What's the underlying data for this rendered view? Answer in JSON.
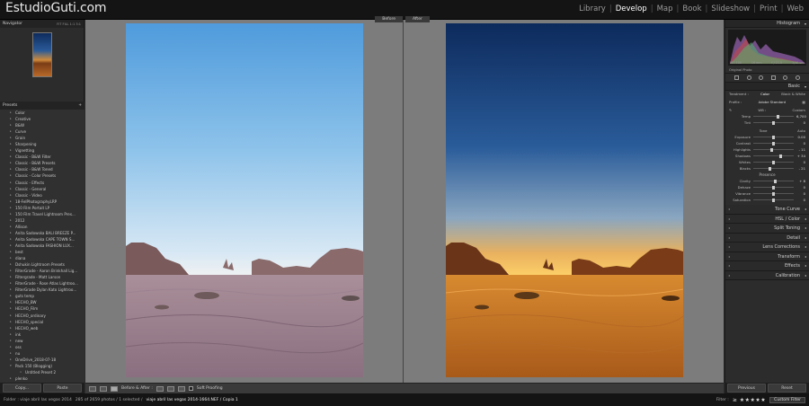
{
  "brand": "EstudioGuti.com",
  "modules": [
    "Library",
    "Develop",
    "Map",
    "Book",
    "Slideshow",
    "Print",
    "Web"
  ],
  "active_module": "Develop",
  "left": {
    "navigator_title": "Navigator",
    "navigator_zoom": "FIT  FILL  1:1  3:1",
    "presets_title": "Presets",
    "presets": [
      "Color",
      "Creative",
      "B&W",
      "Curve",
      "Grain",
      "Sharpening",
      "Vignetting",
      "Classic - B&W Filter",
      "Classic - B&W Presets",
      "Classic - B&W Toned",
      "Classic - Color Presets",
      "Classic - Effects",
      "Classic - General",
      "Classic - Video",
      "18-FelPhotographyLRP",
      "150 Film Portait LP",
      "150 Film Travel Lightroom Pres...",
      "2012",
      "Allison",
      "Anita Sadowska BALI BREEZE P...",
      "Anita Sadowska CAPE TOWN S...",
      "Anita Sadowska FASHION LUX...",
      "best",
      "diana",
      "Dshukin Lightroom Presets",
      "FilterGrade - Aaron Brinkhall Lig...",
      "Filtergrade - Matt Larson",
      "FilterGrade - Rose Atlas Lightroo...",
      "FilterGrade Dylan Kato Lightroo...",
      "guts temp",
      "HECHO_BW",
      "HECHO_Film",
      "HECHO_ordinary",
      "HECHO_special",
      "HECHO_web",
      "ink",
      "new",
      "oss",
      "nu",
      "OneDrive_2018-07-18",
      "Pack 150 (Blogging)"
    ],
    "sub_preset": "Untitled Preset 2",
    "last_preset": "plenko",
    "copy_label": "Copy...",
    "paste_label": "Paste"
  },
  "center": {
    "before_label": "Before",
    "after_label": "After"
  },
  "toolbar": {
    "view_mode": "Before & After :",
    "soft_proofing": "Soft Proofing"
  },
  "right": {
    "histogram_title": "Histogram",
    "histo_values": [
      "ISO 100",
      "16 mm",
      "f / 11.0",
      "1/40 sec"
    ],
    "original_photo": "Original Photo",
    "basic_title": "Basic",
    "treatment_label": "Treatment :",
    "treatment_color": "Color",
    "treatment_bw": "Black & White",
    "profile_label": "Profile :",
    "profile_value": "Adobe Standard",
    "wb_label": "WB :",
    "wb_value": "Custom",
    "tone_label": "Tone",
    "tone_auto": "Auto",
    "presence_label": "Presence",
    "sliders_wb": [
      {
        "label": "Temp",
        "value": "6,700",
        "pos": 0.62
      },
      {
        "label": "Tint",
        "value": "0",
        "pos": 0.5
      }
    ],
    "sliders_tone": [
      {
        "label": "Exposure",
        "value": "0.00",
        "pos": 0.5
      },
      {
        "label": "Contrast",
        "value": "0",
        "pos": 0.5
      },
      {
        "label": "Highlights",
        "value": "- 11",
        "pos": 0.45
      },
      {
        "label": "Shadows",
        "value": "+ 34",
        "pos": 0.67
      },
      {
        "label": "Whites",
        "value": "0",
        "pos": 0.5
      },
      {
        "label": "Blacks",
        "value": "- 21",
        "pos": 0.4
      }
    ],
    "sliders_presence": [
      {
        "label": "Clarity",
        "value": "+ 8",
        "pos": 0.54
      },
      {
        "label": "Dehaze",
        "value": "0",
        "pos": 0.5
      },
      {
        "label": "Vibrance",
        "value": "0",
        "pos": 0.5
      },
      {
        "label": "Saturation",
        "value": "0",
        "pos": 0.5
      }
    ],
    "panels": [
      "Tone Curve",
      "HSL / Color",
      "Split Toning",
      "Detail",
      "Lens Corrections",
      "Transform",
      "Effects",
      "Calibration"
    ],
    "previous_label": "Previous",
    "reset_label": "Reset"
  },
  "filmbar": {
    "folder": "Folder : viaje abril las vegas 2014",
    "count": "285 of 2659 photos / 1 selected /",
    "filename": "viaje abril las vegas 2014-1664.NEF / Copia 1",
    "filter_label": "Filter :",
    "stars": "≥ ★★★★★",
    "custom_filter": "Custom Filter"
  }
}
